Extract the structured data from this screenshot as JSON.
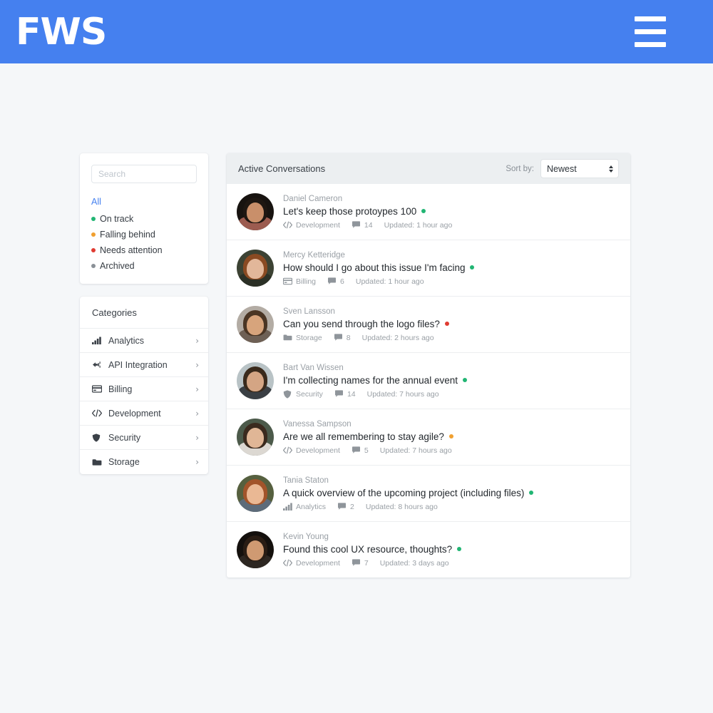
{
  "header": {
    "brand": "FWS",
    "menu_icon": "hamburger-icon",
    "bg_color": "#4580ef"
  },
  "sidebar": {
    "search": {
      "placeholder": "Search",
      "value": ""
    },
    "filters": [
      {
        "label": "All",
        "color": "#4580ef",
        "dot": false,
        "active": true
      },
      {
        "label": "On track",
        "color": "#21b573",
        "dot": true,
        "active": false
      },
      {
        "label": "Falling behind",
        "color": "#f0a030",
        "dot": true,
        "active": false
      },
      {
        "label": "Needs attention",
        "color": "#e03b32",
        "dot": true,
        "active": false
      },
      {
        "label": "Archived",
        "color": "#8a9097",
        "dot": true,
        "active": false
      }
    ],
    "categories_title": "Categories",
    "categories": [
      {
        "label": "Analytics",
        "icon": "bar-chart-icon",
        "chevron": "›"
      },
      {
        "label": "API Integration",
        "icon": "plug-icon",
        "chevron": "›"
      },
      {
        "label": "Billing",
        "icon": "credit-card-icon",
        "chevron": "›"
      },
      {
        "label": "Development",
        "icon": "code-icon",
        "chevron": "›"
      },
      {
        "label": "Security",
        "icon": "shield-icon",
        "chevron": "›"
      },
      {
        "label": "Storage",
        "icon": "folder-icon",
        "chevron": "›"
      }
    ]
  },
  "main": {
    "panel_title": "Active Conversations",
    "sort": {
      "label": "Sort by:",
      "selected": "Newest",
      "options": [
        "Newest"
      ]
    },
    "conversations": [
      {
        "name": "Daniel Cameron",
        "subject": "Let's keep those protoypes 100",
        "status_color": "#21b573",
        "category": "Development",
        "category_icon": "code-icon",
        "comments": "14",
        "comments_icon": "comment-icon",
        "updated": "Updated: 1 hour ago",
        "avatar": {
          "skin": "#c98f6a",
          "hair": "#1e1712",
          "bg": "#171310",
          "shirt": "#9c5c50"
        }
      },
      {
        "name": "Mercy Ketteridge",
        "subject": "How should I go about this issue I'm facing",
        "status_color": "#21b573",
        "category": "Billing",
        "category_icon": "credit-card-icon",
        "comments": "6",
        "comments_icon": "comment-icon",
        "updated": "Updated: 1 hour ago",
        "avatar": {
          "skin": "#e2b79a",
          "hair": "#8a4a22",
          "bg": "#3c4233",
          "shirt": "#2b3026"
        }
      },
      {
        "name": "Sven Lansson",
        "subject": "Can you send through the logo files?",
        "status_color": "#e03b32",
        "category": "Storage",
        "category_icon": "folder-icon",
        "comments": "8",
        "comments_icon": "comment-icon",
        "updated": "Updated: 2 hours ago",
        "avatar": {
          "skin": "#d7a47c",
          "hair": "#4a3524",
          "bg": "#b3aca4",
          "shirt": "#6e6055"
        }
      },
      {
        "name": "Bart Van Wissen",
        "subject": "I'm collecting names for the annual event",
        "status_color": "#21b573",
        "category": "Security",
        "category_icon": "shield-icon",
        "comments": "14",
        "comments_icon": "comment-icon",
        "updated": "Updated: 7 hours ago",
        "avatar": {
          "skin": "#d4a584",
          "hair": "#3a2a1c",
          "bg": "#b9c3c6",
          "shirt": "#3a3f44"
        }
      },
      {
        "name": "Vanessa Sampson",
        "subject": "Are we all remembering to stay agile?",
        "status_color": "#f0a030",
        "category": "Development",
        "category_icon": "code-icon",
        "comments": "5",
        "comments_icon": "comment-icon",
        "updated": "Updated: 7 hours ago",
        "avatar": {
          "skin": "#e0b696",
          "hair": "#3b2a1e",
          "bg": "#4c5a4a",
          "shirt": "#dcd8d2"
        }
      },
      {
        "name": "Tania Staton",
        "subject": "A quick overview of the upcoming project (including files)",
        "status_color": "#21b573",
        "category": "Analytics",
        "category_icon": "bar-chart-icon",
        "comments": "2",
        "comments_icon": "comment-icon",
        "updated": "Updated: 8 hours ago",
        "avatar": {
          "skin": "#eab894",
          "hair": "#a2542a",
          "bg": "#56603f",
          "shirt": "#5d6b7a"
        }
      },
      {
        "name": "Kevin Young",
        "subject": "Found this cool UX resource, thoughts?",
        "status_color": "#21b573",
        "category": "Development",
        "category_icon": "code-icon",
        "comments": "7",
        "comments_icon": "comment-icon",
        "updated": "Updated: 3 days ago",
        "avatar": {
          "skin": "#cf9a72",
          "hair": "#2a1d14",
          "bg": "#14100d",
          "shirt": "#2d2722"
        }
      }
    ]
  }
}
